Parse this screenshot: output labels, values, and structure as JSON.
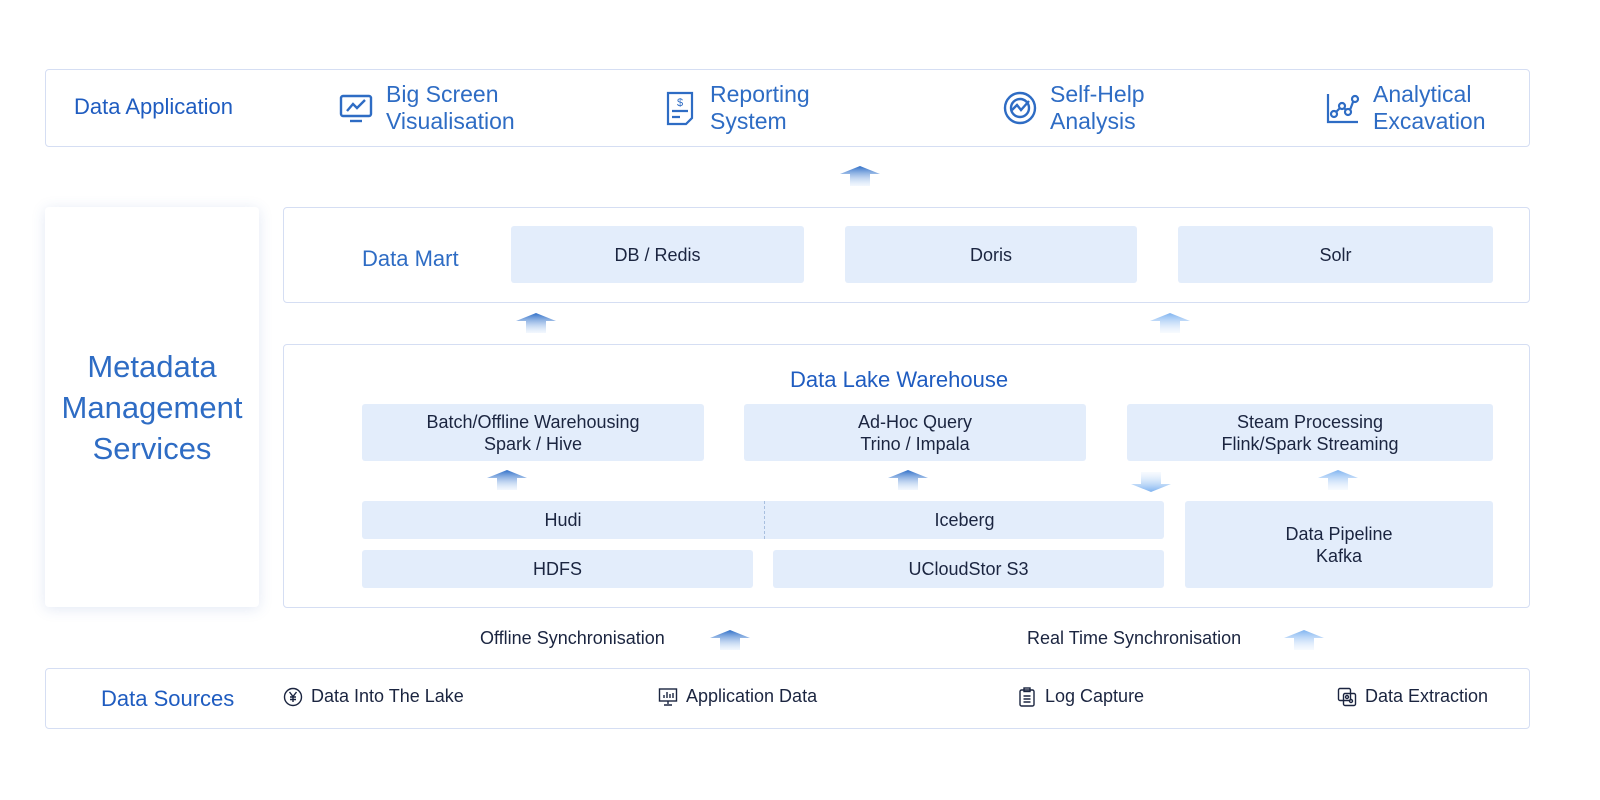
{
  "data_application": {
    "label": "Data Application",
    "items": [
      {
        "icon": "monitor-chart-icon",
        "label_line1": "Big Screen",
        "label_line2": "Visualisation"
      },
      {
        "icon": "invoice-dollar-icon",
        "label_line1": "Reporting",
        "label_line2": "System"
      },
      {
        "icon": "analysis-gauge-icon",
        "label_line1": "Self-Help",
        "label_line2": "Analysis"
      },
      {
        "icon": "line-chart-nodes-icon",
        "label_line1": "Analytical",
        "label_line2": "Excavation"
      }
    ]
  },
  "metadata": {
    "line1": "Metadata",
    "line2": "Management",
    "line3": "Services"
  },
  "data_mart": {
    "label": "Data Mart",
    "items": [
      "DB / Redis",
      "Doris",
      "Solr"
    ]
  },
  "lake": {
    "title": "Data Lake Warehouse",
    "engines": [
      {
        "line1": "Batch/Offline Warehousing",
        "line2": "Spark / Hive"
      },
      {
        "line1": "Ad-Hoc Query",
        "line2": "Trino / Impala"
      },
      {
        "line1": "Steam Processing",
        "line2": "Flink/Spark Streaming"
      }
    ],
    "table_formats": [
      "Hudi",
      "Iceberg"
    ],
    "storage": [
      "HDFS",
      "UCloudStor S3"
    ],
    "pipeline": {
      "line1": "Data Pipeline",
      "line2": "Kafka"
    }
  },
  "sync": {
    "offline": "Offline Synchronisation",
    "realtime": "Real Time Synchronisation"
  },
  "data_sources": {
    "label": "Data Sources",
    "items": [
      {
        "icon": "yen-circle-icon",
        "label": "Data Into The Lake"
      },
      {
        "icon": "monitor-bars-icon",
        "label": "Application Data"
      },
      {
        "icon": "clipboard-icon",
        "label": "Log Capture"
      },
      {
        "icon": "database-extract-icon",
        "label": "Data Extraction"
      }
    ]
  },
  "colors": {
    "accent": "#1f5cc0",
    "cell": "#e3edfb",
    "border": "#d5def3"
  }
}
